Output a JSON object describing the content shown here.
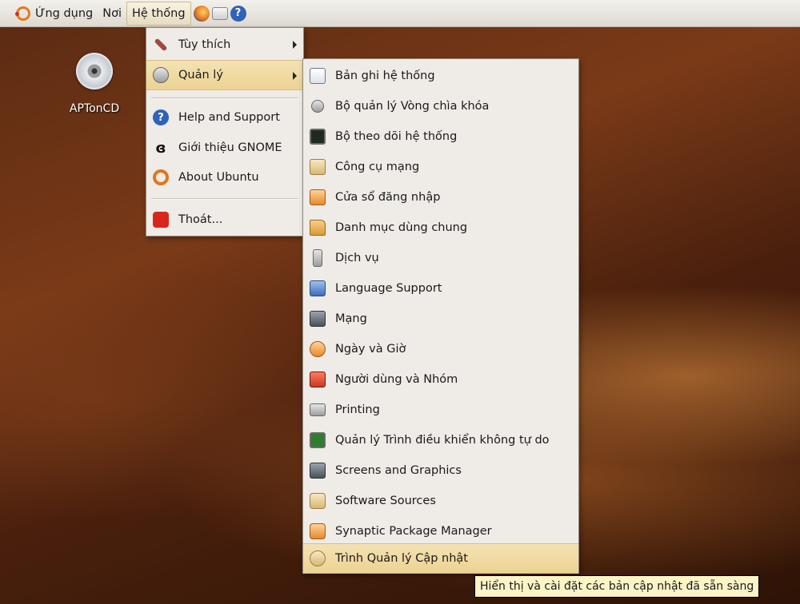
{
  "top_panel": {
    "applications_label": "Ứng dụng",
    "places_label": "Nơi",
    "system_label": "Hệ thống"
  },
  "desktop": {
    "icon_label": "APTonCD"
  },
  "system_menu": {
    "items": [
      {
        "label": "Tùy thích",
        "icon": "preferences-icon"
      },
      {
        "label": "Quản lý",
        "icon": "administration-gear-icon"
      },
      {
        "label": "Help and Support",
        "icon": "help-icon"
      },
      {
        "label": "Giới thiệu GNOME",
        "icon": "gnome-foot-icon"
      },
      {
        "label": "About Ubuntu",
        "icon": "ubuntu-logo-icon"
      },
      {
        "label": "Thoát...",
        "icon": "power-icon"
      }
    ]
  },
  "admin_menu": {
    "items": [
      {
        "label": "Bản ghi hệ thống",
        "icon": "log-viewer-icon"
      },
      {
        "label": "Bộ quản lý Vòng chìa khóa",
        "icon": "keyring-icon"
      },
      {
        "label": "Bộ theo dõi hệ thống",
        "icon": "system-monitor-icon"
      },
      {
        "label": "Công cụ mạng",
        "icon": "network-tools-icon"
      },
      {
        "label": "Cửa sổ đăng nhập",
        "icon": "login-window-icon"
      },
      {
        "label": "Danh mục dùng chung",
        "icon": "shared-folders-icon"
      },
      {
        "label": "Dịch vụ",
        "icon": "services-icon"
      },
      {
        "label": "Language Support",
        "icon": "language-flag-icon"
      },
      {
        "label": "Mạng",
        "icon": "network-icon"
      },
      {
        "label": "Ngày và Giờ",
        "icon": "date-time-icon"
      },
      {
        "label": "Người dùng và Nhóm",
        "icon": "users-groups-icon"
      },
      {
        "label": "Printing",
        "icon": "printer-icon"
      },
      {
        "label": "Quản lý Trình điều khiển không tự do",
        "icon": "restricted-drivers-icon"
      },
      {
        "label": "Screens and Graphics",
        "icon": "display-icon"
      },
      {
        "label": "Software Sources",
        "icon": "software-sources-icon"
      },
      {
        "label": "Synaptic Package Manager",
        "icon": "synaptic-icon"
      },
      {
        "label": "Trình Quản lý Cập nhật",
        "icon": "update-manager-icon"
      }
    ]
  },
  "tooltip": {
    "text": "Hiển thị và cài đặt các bản cập nhật đã sẵn sàng"
  }
}
